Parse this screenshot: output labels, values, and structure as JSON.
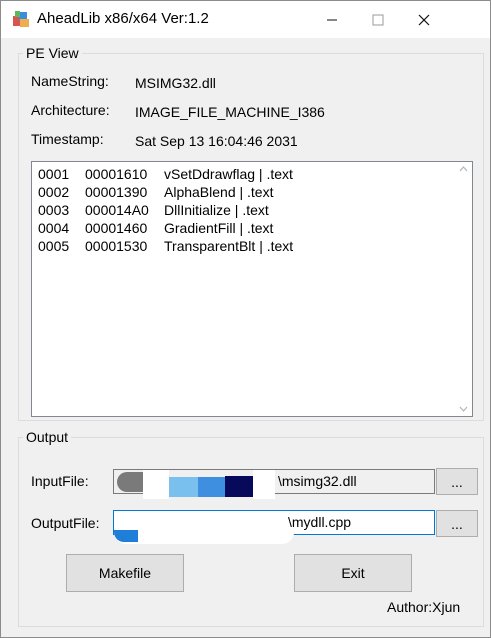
{
  "window": {
    "title": "AheadLib x86/x64  Ver:1.2",
    "minimize_glyph": "—",
    "maximize_glyph": "☐",
    "close_glyph": "✕"
  },
  "pe_view": {
    "label": "PE View",
    "namestring_label": "NameString:",
    "namestring_value": "MSIMG32.dll",
    "architecture_label": "Architecture:",
    "architecture_value": "IMAGE_FILE_MACHINE_I386",
    "timestamp_label": "Timestamp:",
    "timestamp_value": "Sat Sep 13 16:04:46 2031",
    "exports": [
      {
        "ordinal": "0001",
        "rva": "00001610",
        "name": "vSetDdrawflag | .text"
      },
      {
        "ordinal": "0002",
        "rva": "00001390",
        "name": "AlphaBlend | .text"
      },
      {
        "ordinal": "0003",
        "rva": "000014A0",
        "name": "DllInitialize | .text"
      },
      {
        "ordinal": "0004",
        "rva": "00001460",
        "name": "GradientFill | .text"
      },
      {
        "ordinal": "0005",
        "rva": "00001530",
        "name": "TransparentBlt | .text"
      }
    ]
  },
  "output": {
    "label": "Output",
    "inputfile_label": "InputFile:",
    "inputfile_value": "\\msimg32.dll",
    "outputfile_label": "OutputFile:",
    "outputfile_value": "\\mydll.cpp",
    "browse_label": "...",
    "makefile_label": "Makefile",
    "exit_label": "Exit",
    "author": "Author:Xjun"
  }
}
